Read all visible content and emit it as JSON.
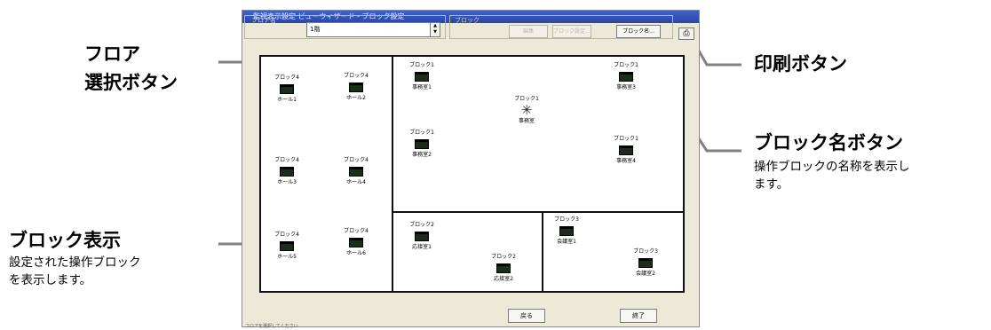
{
  "window": {
    "title": "監視表示設定 ビューウィザード - ブロック設定",
    "floor_group_label": "フロア名",
    "floor_value": "1階",
    "block_group_label": "ブロック",
    "toolbar_buttons": [
      "編集",
      "ブロック設定...",
      "ブロック名..."
    ],
    "print_icon": "printer-icon",
    "back_button": "戻る",
    "exit_button": "終了",
    "status_text": "フロアを選択してください"
  },
  "blocks": [
    {
      "block": "ブロック4",
      "name": "ホール1",
      "icon": "indoor-unit-icon"
    },
    {
      "block": "ブロック4",
      "name": "ホール2",
      "icon": "indoor-unit-icon"
    },
    {
      "block": "ブロック4",
      "name": "ホール3",
      "icon": "indoor-unit-icon"
    },
    {
      "block": "ブロック4",
      "name": "ホール4",
      "icon": "indoor-unit-icon"
    },
    {
      "block": "ブロック4",
      "name": "ホール5",
      "icon": "indoor-unit-icon"
    },
    {
      "block": "ブロック4",
      "name": "ホール6",
      "icon": "indoor-unit-icon"
    },
    {
      "block": "ブロック1",
      "name": "事務室1",
      "icon": "indoor-unit-icon"
    },
    {
      "block": "ブロック1",
      "name": "事務室3",
      "icon": "indoor-unit-icon"
    },
    {
      "block": "ブロック1",
      "name": "事務室",
      "icon": "ventilation-fan-icon"
    },
    {
      "block": "ブロック1",
      "name": "事務室2",
      "icon": "indoor-unit-icon"
    },
    {
      "block": "ブロック1",
      "name": "事務室4",
      "icon": "indoor-unit-icon"
    },
    {
      "block": "ブロック2",
      "name": "応接室1",
      "icon": "indoor-unit-icon"
    },
    {
      "block": "ブロック2",
      "name": "応接室2",
      "icon": "indoor-unit-icon"
    },
    {
      "block": "ブロック3",
      "name": "会議室1",
      "icon": "indoor-unit-icon"
    },
    {
      "block": "ブロック3",
      "name": "会議室2",
      "icon": "indoor-unit-icon"
    }
  ],
  "annotations": {
    "floor_select": {
      "line1": "フロア",
      "line2": "選択ボタン"
    },
    "print": {
      "title": "印刷ボタン"
    },
    "block_name": {
      "title": "ブロック名ボタン",
      "desc": "操作ブロックの名称を表示し\nます。"
    },
    "block_display": {
      "title": "ブロック表示",
      "desc": "設定された操作ブロック\nを表示します。"
    }
  },
  "colors": {
    "titlebar": "#2a46a6",
    "window_bg": "#ece9d8",
    "leader_line": "#808080"
  }
}
